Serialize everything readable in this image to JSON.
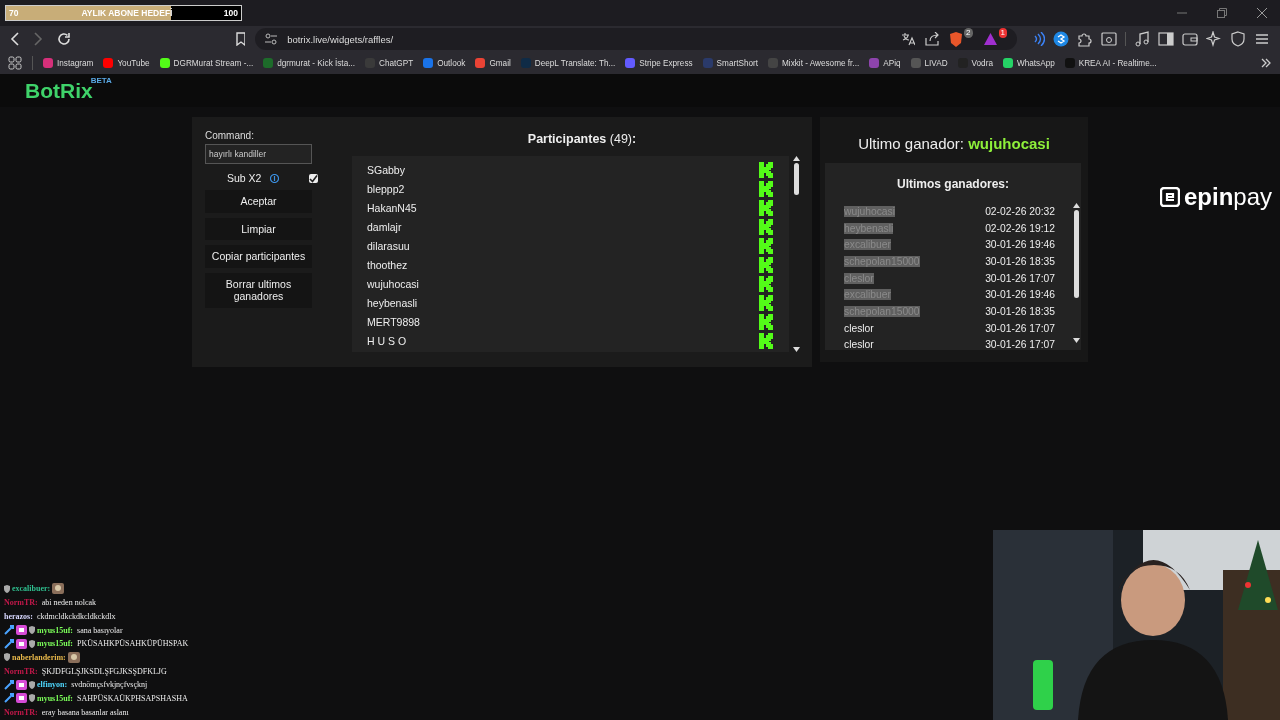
{
  "sub_goal": {
    "current": "70",
    "label": "AYLIK ABONE HEDEFİ",
    "target": "100",
    "level": 0.7
  },
  "address_bar": {
    "url": "botrix.live/widgets/raffles/"
  },
  "extension_badges": [
    "2",
    "1"
  ],
  "bookmarks": [
    {
      "label": "Instagram",
      "color": "#d6307a"
    },
    {
      "label": "YouTube",
      "color": "#ff0000"
    },
    {
      "label": "DGRMurat Stream -...",
      "color": "#53fc18"
    },
    {
      "label": "dgrmurat - Kick İsta...",
      "color": "#1d6b2a"
    },
    {
      "label": "ChatGPT",
      "color": "#3a3a3a"
    },
    {
      "label": "Outlook",
      "color": "#1a73e8"
    },
    {
      "label": "Gmail",
      "color": "#ea4335"
    },
    {
      "label": "DeepL Translate: Th...",
      "color": "#0f2b46"
    },
    {
      "label": "Stripe Express",
      "color": "#635bff"
    },
    {
      "label": "SmartShort",
      "color": "#2a3a6a"
    },
    {
      "label": "Mixkit - Awesome fr...",
      "color": "#444444"
    },
    {
      "label": "APiq",
      "color": "#8e44ad"
    },
    {
      "label": "LIVAD",
      "color": "#555555"
    },
    {
      "label": "Vodra",
      "color": "#222222"
    },
    {
      "label": "WhatsApp",
      "color": "#25d366"
    },
    {
      "label": "KREA AI - Realtime...",
      "color": "#111111"
    }
  ],
  "site": {
    "logo": "BotRix",
    "logo_badge": "BETA"
  },
  "raffle": {
    "command_label": "Command:",
    "command_value": "hayırlı kandiller",
    "sub_x2": {
      "label": "Sub X2",
      "checked": true
    },
    "buttons": [
      "Aceptar",
      "Limpiar",
      "Copiar participantes",
      "Borrar ultimos ganadores"
    ],
    "participants_title": "Participantes",
    "participants_count": "(49)",
    "participants_colon": ":",
    "participants": [
      "SGabby",
      "bleppp2",
      "HakanN45",
      "damlajr",
      "dilarasuu",
      "thoothez",
      "wujuhocasi",
      "heybenasli",
      "MERT9898",
      "H U S O"
    ]
  },
  "winner": {
    "label": "Ultimo ganador:",
    "name": "wujuhocasi",
    "list_title": "Ultimos ganadores:",
    "list": [
      {
        "name": "wujuhocasi",
        "time": "02-02-26 20:32",
        "highlighted": true
      },
      {
        "name": "heybenasli",
        "time": "02-02-26 19:12",
        "highlighted": true
      },
      {
        "name": "excalibuer",
        "time": "30-01-26 19:46",
        "highlighted": true
      },
      {
        "name": "schepolan15000",
        "time": "30-01-26 18:35",
        "highlighted": true
      },
      {
        "name": "cleslor",
        "time": "30-01-26 17:07",
        "highlighted": true
      },
      {
        "name": "excalibuer",
        "time": "30-01-26 19:46",
        "highlighted": true
      },
      {
        "name": "schepolan15000",
        "time": "30-01-26 18:35",
        "highlighted": true
      },
      {
        "name": "cleslor",
        "time": "30-01-26 17:07",
        "highlighted": false
      },
      {
        "name": "cleslor",
        "time": "30-01-26 17:07",
        "highlighted": false
      }
    ]
  },
  "sponsor": {
    "logo_bold": "epin",
    "logo_light": "pay"
  },
  "chat": [
    {
      "user": "excalibuer:",
      "color": "#2fbf8f",
      "kind": "shield",
      "emote": true
    },
    {
      "user": "NormTR:",
      "color": "#c2184a",
      "text": "abi neden nolcak",
      "kind": "plain",
      "emote": false
    },
    {
      "user": "herazos:",
      "color": "#d8d8ff",
      "text": "ckdmcldkckdkcldkckdlx",
      "kind": "plain",
      "emote": false
    },
    {
      "user": "myus15uf:",
      "color": "#7cff5a",
      "text": "sana basıyolar",
      "kind": "badged",
      "emote": false
    },
    {
      "user": "myus15uf:",
      "color": "#7cff5a",
      "text": "PKÜSAHKPÜSAHKÜPÜHSPAK",
      "kind": "badged",
      "emote": false
    },
    {
      "user": "naberlanderim:",
      "color": "#e8b84a",
      "kind": "shield",
      "emote": true
    },
    {
      "user": "NormTR:",
      "color": "#c2184a",
      "text": "ŞKJDFGLŞJKSDLŞFGJKSŞDFKLJG",
      "kind": "plain",
      "emote": false
    },
    {
      "user": "elfinyon:",
      "color": "#4fd8ff",
      "text": "svdnömçsfvkjnçfvsçknj",
      "kind": "badged",
      "emote": false
    },
    {
      "user": "myus15uf:",
      "color": "#7cff5a",
      "text": "SAHPÜSKAÜKPHSAPSHASHA",
      "kind": "badged",
      "emote": false
    },
    {
      "user": "NormTR:",
      "color": "#c2184a",
      "text": "eray basana basanlar aslanı",
      "kind": "plain",
      "emote": false
    }
  ]
}
